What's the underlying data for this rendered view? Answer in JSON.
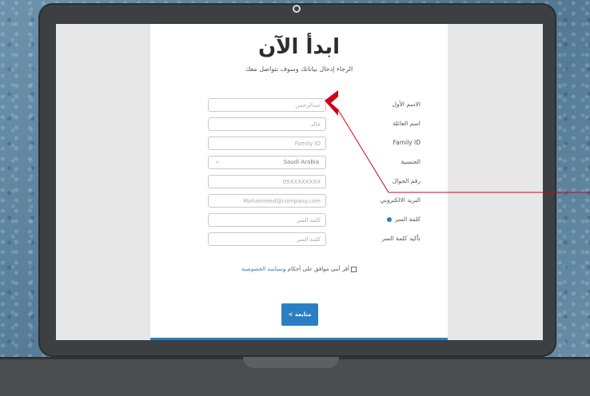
{
  "page": {
    "title": "ابدأ الآن",
    "subtitle": "الرجاء إدخال بياناتك وسوف نتواصل معك"
  },
  "form": {
    "fields": [
      {
        "label": "الاسم الأول",
        "placeholder": "عبدالرحمن"
      },
      {
        "label": "اسم العائلة",
        "placeholder": "خالد"
      },
      {
        "label": "Family ID",
        "placeholder": "Family ID"
      },
      {
        "label": "الجنسية",
        "value": "Saudi Arabia"
      },
      {
        "label": "رقم الجوال",
        "placeholder": "05XXXXXXXX"
      },
      {
        "label": "البريد الالكتروني",
        "placeholder": "Mohammed@company.com"
      },
      {
        "label": "كلمة السر",
        "placeholder": "كلمة السر"
      },
      {
        "label": "تأكيد كلمة السر",
        "placeholder": "كلمة السر"
      }
    ],
    "terms_prefix": "أقر أنني موافق على أحكام و",
    "terms_link": "سياسة الخصوصية",
    "next_button": "متابعة >"
  },
  "colors": {
    "accent": "#2a7fc4",
    "callout": "#d0021b"
  },
  "icons": {
    "select_chevron": "chevron-down-icon",
    "password_info": "info-icon"
  }
}
